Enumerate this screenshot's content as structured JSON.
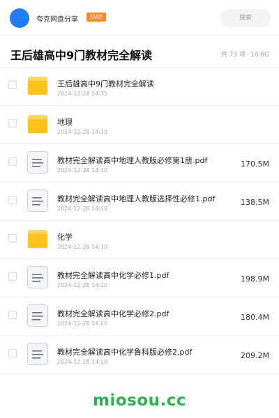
{
  "header": {
    "share_title": "夸克网盘分享",
    "badge": "SVIP",
    "search_placeholder": "搜索"
  },
  "folder": {
    "title": "王后雄高中9门教材完全解读",
    "count_text": "共 73 项",
    "separator": "·",
    "total_size": "10.6G"
  },
  "files": [
    {
      "type": "folder",
      "name": "王后雄高中9门教材完全解读",
      "date": "2024-12-28 14:35",
      "size": ""
    },
    {
      "type": "folder",
      "name": "地理",
      "date": "2024-12-28 14:10",
      "size": ""
    },
    {
      "type": "doc",
      "name": "教材完全解读高中地理人教版必修第1册.pdf",
      "date": "2024-12-28 14:10",
      "size": "170.5M"
    },
    {
      "type": "doc",
      "name": "教材完全解读高中地理人教版选择性必修1.pdf",
      "date": "2024-12-28 14:10",
      "size": "138.5M"
    },
    {
      "type": "folder",
      "name": "化学",
      "date": "2024-12-28 14:10",
      "size": ""
    },
    {
      "type": "doc",
      "name": "教材完全解读高中化学必修1.pdf",
      "date": "2024-12-28 14:10",
      "size": "198.9M"
    },
    {
      "type": "doc",
      "name": "教材完全解读高中化学必修2.pdf",
      "date": "2024-12-28 14:10",
      "size": "180.4M"
    },
    {
      "type": "doc",
      "name": "教材完全解读高中化学鲁科版必修2.pdf",
      "date": "2024-12-28 14:10",
      "size": "209.2M"
    }
  ],
  "icons": {
    "folder": "folder-icon",
    "doc": "document-icon"
  },
  "colors": {
    "avatar": "#1f7cf2",
    "badge": "#ff8b2c",
    "folder_body": "#ffc21a",
    "folder_tab": "#ffd75a",
    "watermark": "#2bb24c"
  },
  "watermark": "miosou.cc"
}
